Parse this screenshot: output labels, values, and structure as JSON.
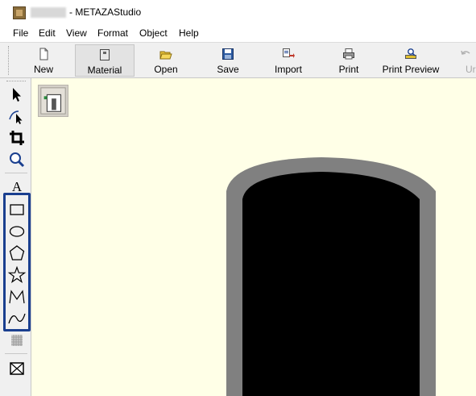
{
  "window": {
    "title": "- METAZAStudio"
  },
  "menu": {
    "items": [
      "File",
      "Edit",
      "View",
      "Format",
      "Object",
      "Help"
    ]
  },
  "toolbar": {
    "buttons": [
      {
        "label": "New",
        "icon": "new-document-icon"
      },
      {
        "label": "Material",
        "icon": "material-icon",
        "active": true
      },
      {
        "label": "Open",
        "icon": "open-folder-icon"
      },
      {
        "label": "Save",
        "icon": "save-disk-icon"
      },
      {
        "label": "Import",
        "icon": "import-icon"
      },
      {
        "label": "Print",
        "icon": "printer-icon"
      },
      {
        "label": "Print Preview",
        "icon": "print-preview-icon"
      },
      {
        "label": "Ur",
        "icon": "undo-icon",
        "disabled": true
      }
    ]
  },
  "palette": {
    "tools": [
      "select-arrow-icon",
      "node-edit-icon",
      "crop-icon",
      "zoom-icon",
      "text-icon",
      "rectangle-icon",
      "ellipse-icon",
      "polygon-icon",
      "star-icon",
      "polyline-icon",
      "curve-icon",
      "pattern-icon",
      "fill-icon"
    ],
    "text_tool_glyph": "A"
  },
  "colors": {
    "canvas_background": "#ffffe7",
    "shape_outer": "#808080",
    "shape_inner": "#000000",
    "highlight_border": "#1a3f8f"
  }
}
